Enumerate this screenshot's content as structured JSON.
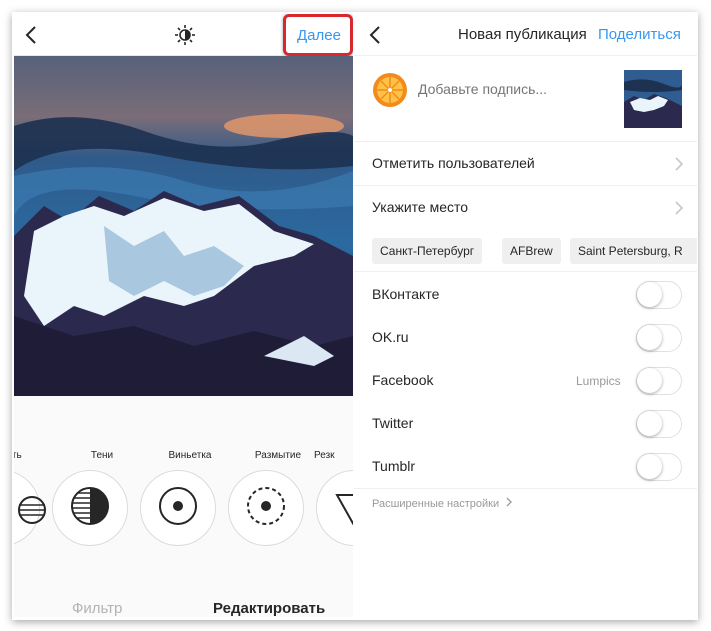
{
  "left_panel": {
    "next_label": "Далее",
    "tools": [
      {
        "label": "ить",
        "icon": "structure-icon"
      },
      {
        "label": "Тени",
        "icon": "shadows-icon"
      },
      {
        "label": "Виньетка",
        "icon": "vignette-icon"
      },
      {
        "label": "Размытие",
        "icon": "blur-icon"
      },
      {
        "label": "Резк",
        "icon": "sharpen-icon"
      }
    ],
    "tabs": {
      "filter": "Фильтр",
      "edit": "Редактировать"
    }
  },
  "right_panel": {
    "title": "Новая публикация",
    "share_label": "Поделиться",
    "caption": {
      "placeholder": "Добавьте подпись..."
    },
    "tag_people": "Отметить пользователей",
    "add_location": "Укажите место",
    "location_chips": [
      "Санкт-Петербург",
      "AFBrew",
      "Saint Petersburg, R"
    ],
    "networks": [
      {
        "name": "ВКонтакте",
        "account": ""
      },
      {
        "name": "OK.ru",
        "account": ""
      },
      {
        "name": "Facebook",
        "account": "Lumpics"
      },
      {
        "name": "Twitter",
        "account": ""
      },
      {
        "name": "Tumblr",
        "account": ""
      }
    ],
    "advanced": "Расширенные настройки"
  },
  "colors": {
    "accent": "#3897f0",
    "highlight": "#d9272e"
  }
}
